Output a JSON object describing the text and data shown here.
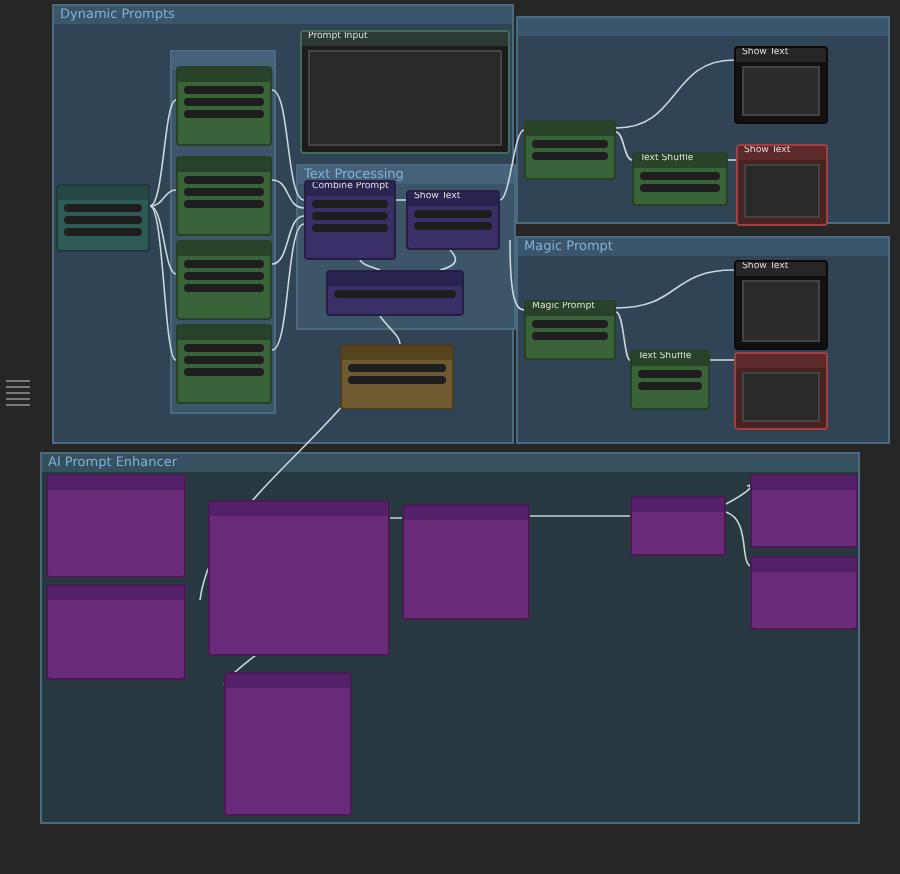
{
  "groups": [
    {
      "title": "Dynamic Prompts",
      "kind": "outer"
    },
    {
      "kind": "inner"
    },
    {
      "title": "Text Processing",
      "kind": "inner"
    },
    {
      "kind": "outer"
    },
    {
      "title": "Magic Prompt",
      "kind": "outer"
    },
    {
      "title": "AI Prompt Enhancer",
      "kind": "wide"
    }
  ],
  "nodes": [
    {
      "kind": "teal"
    },
    {
      "kind": "green"
    },
    {
      "kind": "green"
    },
    {
      "kind": "green"
    },
    {
      "kind": "green"
    },
    {
      "title": "Prompt Input",
      "kind": "note"
    },
    {
      "title": "Combine Prompt",
      "kind": "indigo"
    },
    {
      "title": "Show Text",
      "kind": "indigo"
    },
    {
      "kind": "indigo"
    },
    {
      "kind": "olive"
    },
    {
      "kind": "green"
    },
    {
      "title": "Text Shuffle",
      "kind": "green"
    },
    {
      "title": "Show Text",
      "kind": "black"
    },
    {
      "title": "Show Text",
      "kind": "red"
    },
    {
      "title": "Magic Prompt",
      "kind": "green"
    },
    {
      "title": "Text Shuffle",
      "kind": "green"
    },
    {
      "title": "Show Text",
      "kind": "black"
    },
    {
      "kind": "red"
    },
    {
      "kind": "purple"
    },
    {
      "kind": "purple"
    },
    {
      "kind": "purple"
    },
    {
      "kind": "purple"
    },
    {
      "kind": "purple"
    },
    {
      "kind": "purple"
    },
    {
      "kind": "purple"
    },
    {
      "kind": "purple"
    }
  ]
}
